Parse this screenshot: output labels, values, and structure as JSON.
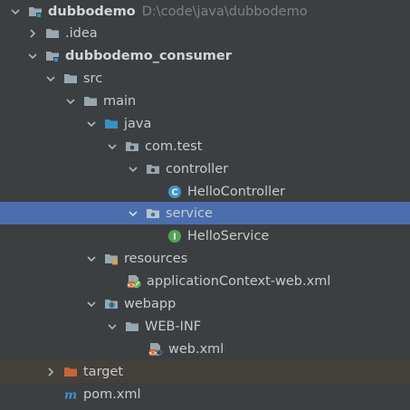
{
  "project_tree": {
    "root": {
      "label": "dubbodemo",
      "path": "D:\\code\\java\\dubbodemo"
    },
    "idea": {
      "label": ".idea"
    },
    "module": {
      "label": "dubbodemo_consumer"
    },
    "src": {
      "label": "src"
    },
    "main": {
      "label": "main"
    },
    "java": {
      "label": "java"
    },
    "package": {
      "label": "com.test"
    },
    "controller": {
      "label": "controller"
    },
    "hello_controller": {
      "label": "HelloController"
    },
    "service": {
      "label": "service"
    },
    "hello_service": {
      "label": "HelloService"
    },
    "resources": {
      "label": "resources"
    },
    "app_context": {
      "label": "applicationContext-web.xml"
    },
    "webapp": {
      "label": "webapp"
    },
    "web_inf": {
      "label": "WEB-INF"
    },
    "web_xml": {
      "label": "web.xml"
    },
    "target": {
      "label": "target"
    },
    "pom": {
      "label": "pom.xml"
    }
  },
  "colors": {
    "background": "#3c3f41",
    "selection": "#4b6eaf",
    "excluded_row": "#45403a",
    "text": "#c8cbce",
    "muted_text": "#808080",
    "folder_gray": "#9aa7b0",
    "source_folder_blue": "#3592c4",
    "excluded_orange": "#c5663a",
    "class_icon": "#3f97c8",
    "interface_icon": "#4fa755",
    "maven_blue": "#3f8fd9"
  }
}
